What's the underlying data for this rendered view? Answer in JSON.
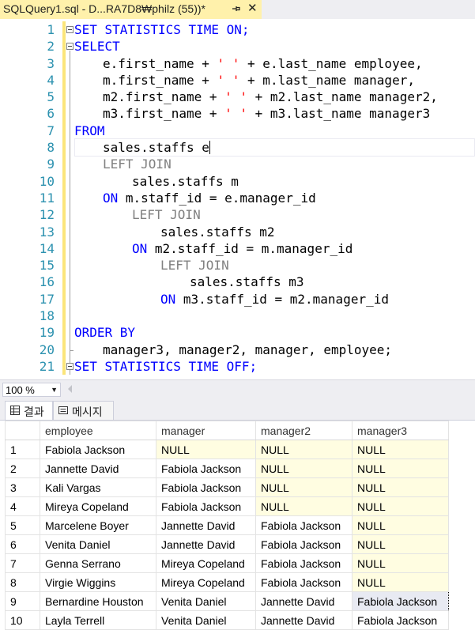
{
  "tab": {
    "title": "SQLQuery1.sql - D...RA7D8₩philz (55))*",
    "close": "✕"
  },
  "editor": {
    "lines": [
      {
        "n": "1"
      },
      {
        "n": "2"
      },
      {
        "n": "3"
      },
      {
        "n": "4"
      },
      {
        "n": "5"
      },
      {
        "n": "6"
      },
      {
        "n": "7"
      },
      {
        "n": "8"
      },
      {
        "n": "9"
      },
      {
        "n": "10"
      },
      {
        "n": "11"
      },
      {
        "n": "12"
      },
      {
        "n": "13"
      },
      {
        "n": "14"
      },
      {
        "n": "15"
      },
      {
        "n": "16"
      },
      {
        "n": "17"
      },
      {
        "n": "18"
      },
      {
        "n": "19"
      },
      {
        "n": "20"
      },
      {
        "n": "21"
      }
    ],
    "code": {
      "l1": "SET STATISTICS TIME ON;",
      "l2": "SELECT",
      "l3a": "e.first_name + ",
      "l3s": "' '",
      "l3b": " + e.last_name employee,",
      "l4a": "m.first_name + ",
      "l4s": "' '",
      "l4b": " + m.last_name manager,",
      "l5a": "m2.first_name + ",
      "l5s": "' '",
      "l5b": " + m2.last_name manager2,",
      "l6a": "m3.first_name + ",
      "l6s": "' '",
      "l6b": " + m3.last_name manager3",
      "l7": "FROM",
      "l8": "sales.staffs e",
      "l9": "LEFT JOIN",
      "l10": "sales.staffs m",
      "l11k": "ON",
      "l11": " m.staff_id = e.manager_id",
      "l12": "LEFT JOIN",
      "l13": "sales.staffs m2",
      "l14k": "ON",
      "l14": " m2.staff_id = m.manager_id",
      "l15": "LEFT JOIN",
      "l16": "sales.staffs m3",
      "l17k": "ON",
      "l17": " m3.staff_id = m2.manager_id",
      "l19": "ORDER BY",
      "l20": "manager3, manager2, manager, employee;",
      "l21": "SET STATISTICS TIME OFF;"
    }
  },
  "zoom": {
    "value": "100 %"
  },
  "results_tabs": [
    {
      "label": "결과"
    },
    {
      "label": "메시지"
    }
  ],
  "grid": {
    "columns": [
      "employee",
      "manager",
      "manager2",
      "manager3"
    ],
    "rows": [
      {
        "n": "1",
        "employee": "Fabiola Jackson",
        "manager": "NULL",
        "manager2": "NULL",
        "manager3": "NULL"
      },
      {
        "n": "2",
        "employee": "Jannette David",
        "manager": "Fabiola Jackson",
        "manager2": "NULL",
        "manager3": "NULL"
      },
      {
        "n": "3",
        "employee": "Kali Vargas",
        "manager": "Fabiola Jackson",
        "manager2": "NULL",
        "manager3": "NULL"
      },
      {
        "n": "4",
        "employee": "Mireya Copeland",
        "manager": "Fabiola Jackson",
        "manager2": "NULL",
        "manager3": "NULL"
      },
      {
        "n": "5",
        "employee": "Marcelene Boyer",
        "manager": "Jannette David",
        "manager2": "Fabiola Jackson",
        "manager3": "NULL"
      },
      {
        "n": "6",
        "employee": "Venita Daniel",
        "manager": "Jannette David",
        "manager2": "Fabiola Jackson",
        "manager3": "NULL"
      },
      {
        "n": "7",
        "employee": "Genna Serrano",
        "manager": "Mireya Copeland",
        "manager2": "Fabiola Jackson",
        "manager3": "NULL"
      },
      {
        "n": "8",
        "employee": "Virgie Wiggins",
        "manager": "Mireya Copeland",
        "manager2": "Fabiola Jackson",
        "manager3": "NULL"
      },
      {
        "n": "9",
        "employee": "Bernardine Houston",
        "manager": "Venita Daniel",
        "manager2": "Jannette David",
        "manager3": "Fabiola Jackson"
      },
      {
        "n": "10",
        "employee": "Layla Terrell",
        "manager": "Venita Daniel",
        "manager2": "Jannette David",
        "manager3": "Fabiola Jackson"
      }
    ]
  },
  "colors": {
    "keyword": "#0000ff",
    "gray_keyword": "#808080",
    "string": "#ff0000",
    "line_number": "#2b91af",
    "tab_active": "#fff1ab",
    "null_cell": "#fffde1"
  }
}
